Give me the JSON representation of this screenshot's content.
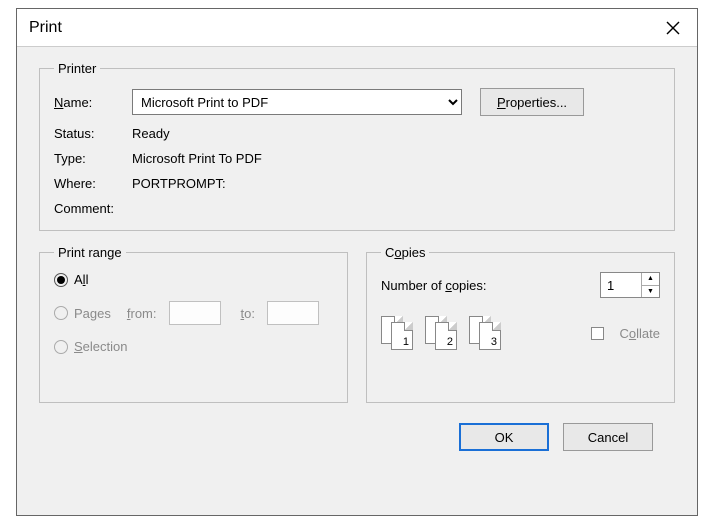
{
  "window": {
    "title": "Print"
  },
  "printer": {
    "group_label": "Printer",
    "name_label": "Name:",
    "name_value": "Microsoft Print to PDF",
    "properties_button": "Properties...",
    "status_label": "Status:",
    "status_value": "Ready",
    "type_label": "Type:",
    "type_value": "Microsoft Print To PDF",
    "where_label": "Where:",
    "where_value": "PORTPROMPT:",
    "comment_label": "Comment:",
    "comment_value": ""
  },
  "range": {
    "group_label": "Print range",
    "all_label": "All",
    "pages_label": "Pages",
    "from_label": "from:",
    "to_label": "to:",
    "from_value": "",
    "to_value": "",
    "selection_label": "Selection"
  },
  "copies": {
    "group_label": "Copies",
    "number_label": "Number of copies:",
    "number_value": "1",
    "collate_label": "Collate",
    "stack1": "1",
    "stack2": "2",
    "stack3": "3"
  },
  "footer": {
    "ok": "OK",
    "cancel": "Cancel"
  }
}
